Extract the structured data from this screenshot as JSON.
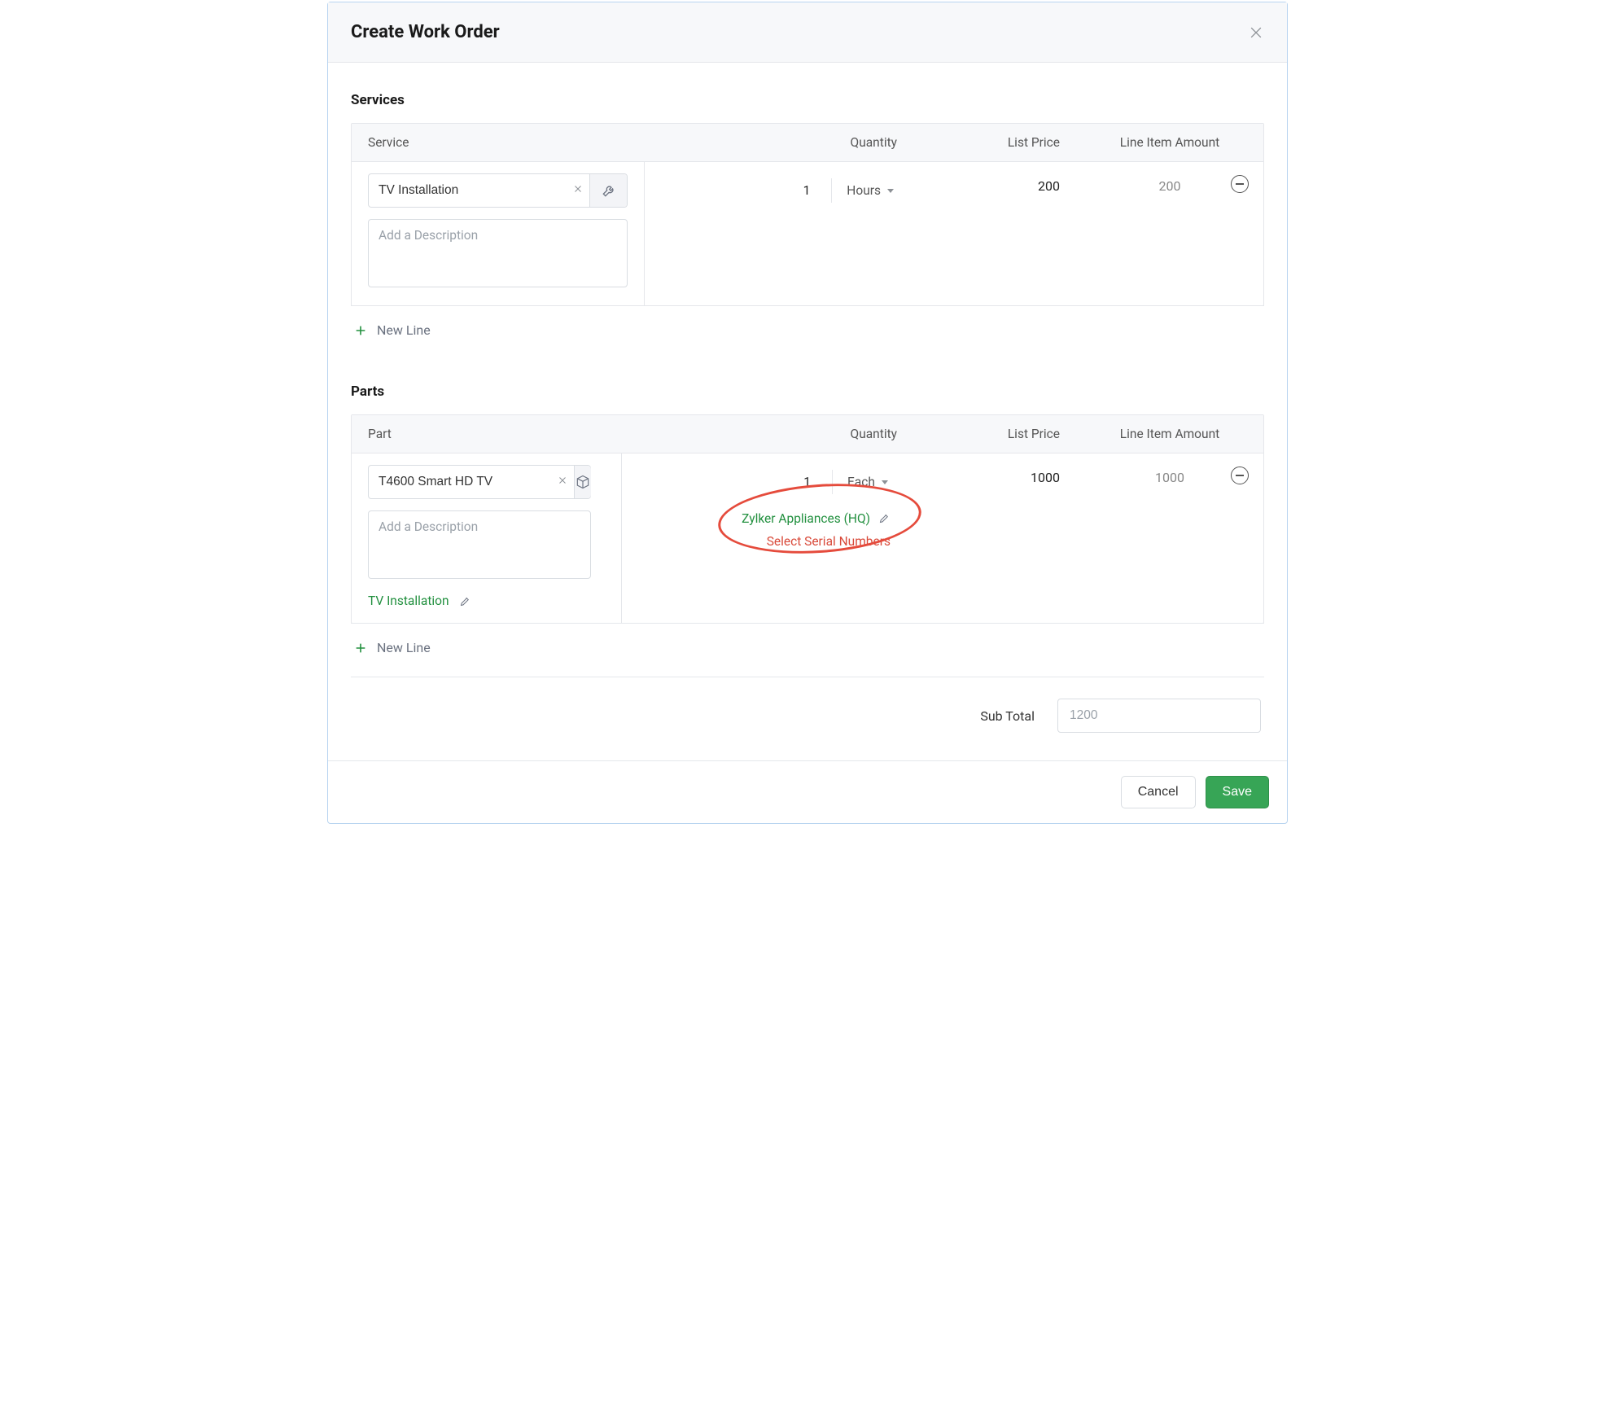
{
  "header": {
    "title": "Create Work Order"
  },
  "services": {
    "title": "Services",
    "columns": {
      "item": "Service",
      "qty": "Quantity",
      "price": "List Price",
      "amount": "Line Item Amount"
    },
    "rows": [
      {
        "name": "TV Installation",
        "desc_placeholder": "Add a Description",
        "quantity": "1",
        "unit": "Hours",
        "list_price": "200",
        "amount": "200"
      }
    ],
    "new_line": "New Line"
  },
  "parts": {
    "title": "Parts",
    "columns": {
      "item": "Part",
      "qty": "Quantity",
      "price": "List Price",
      "amount": "Line Item Amount"
    },
    "rows": [
      {
        "name": "T4600 Smart HD TV",
        "desc_placeholder": "Add a Description",
        "quantity": "1",
        "unit": "Each",
        "list_price": "1000",
        "amount": "1000",
        "warehouse": "Zylker Appliances (HQ)",
        "serial_link": "Select Serial Numbers",
        "assoc_service": "TV Installation"
      }
    ],
    "new_line": "New Line"
  },
  "subtotal": {
    "label": "Sub Total",
    "value": "1200"
  },
  "footer": {
    "cancel": "Cancel",
    "save": "Save"
  }
}
